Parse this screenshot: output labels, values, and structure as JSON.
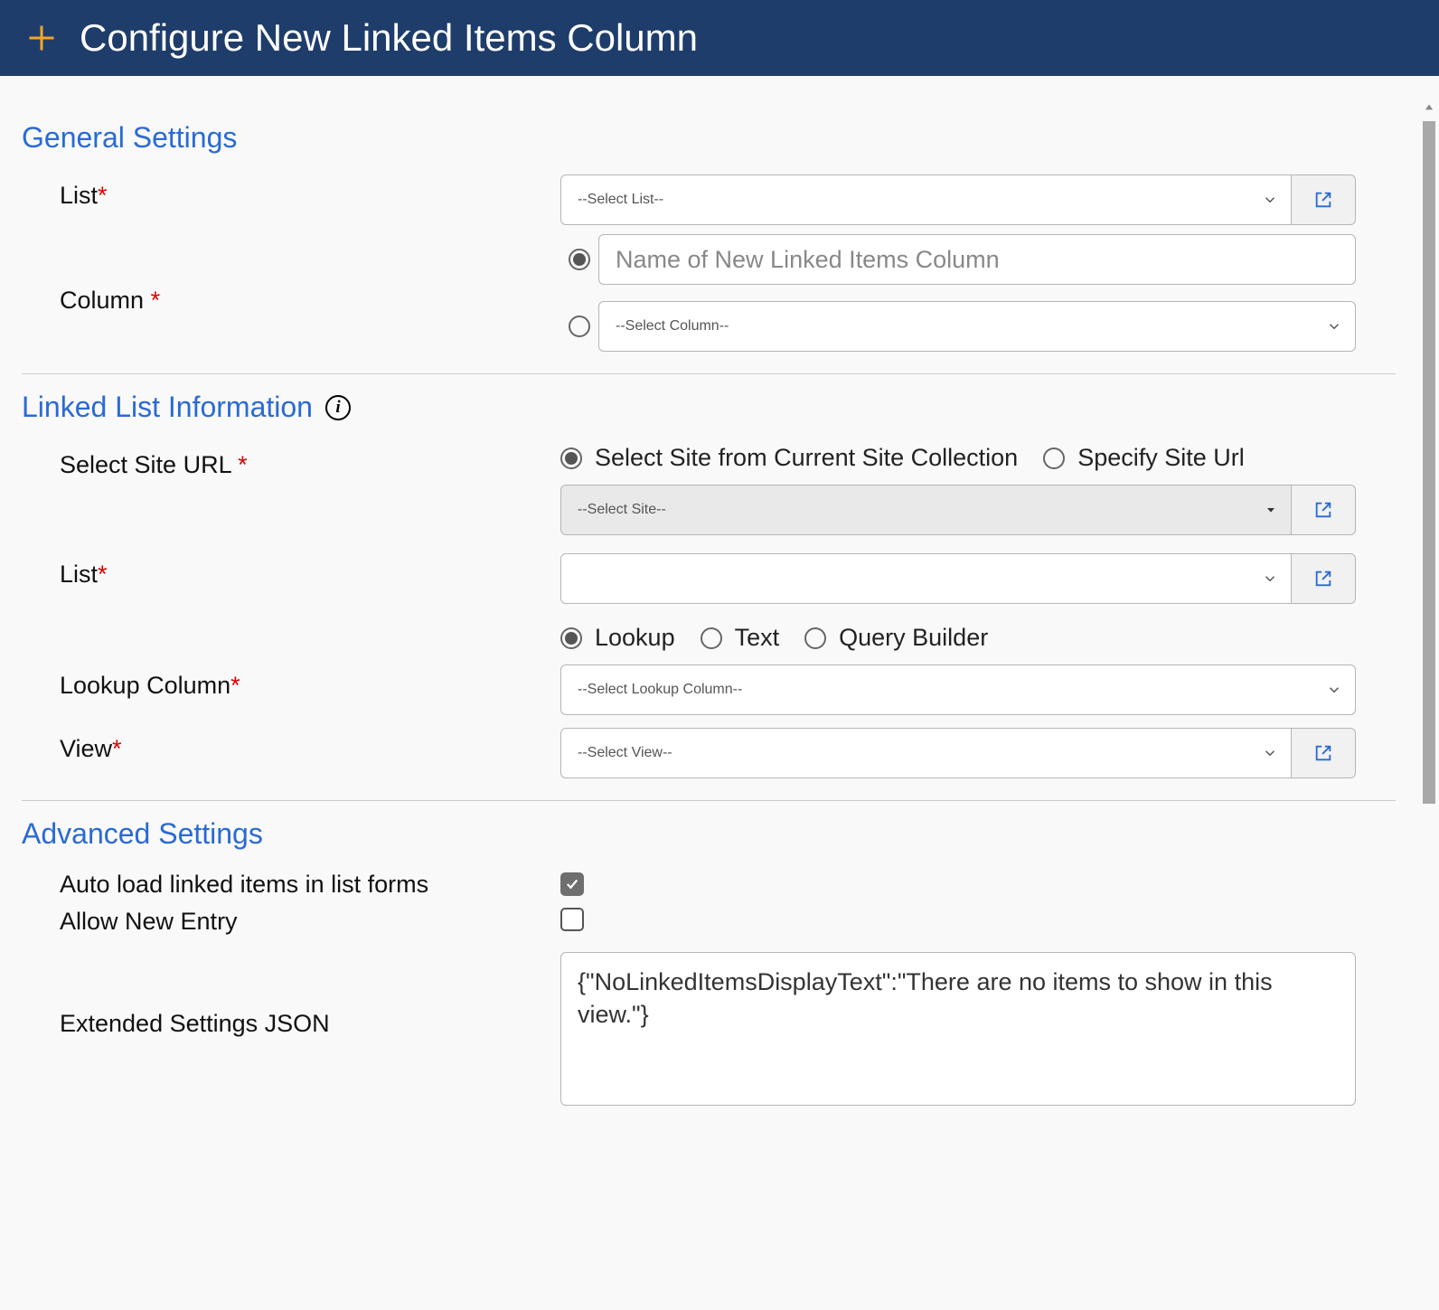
{
  "header": {
    "title": "Configure New Linked Items Column"
  },
  "sections": {
    "general": {
      "title": "General Settings",
      "listLabel": "List",
      "listSelect": "--Select List--",
      "columnLabel": "Column",
      "newColPlaceholder": "Name of New Linked Items Column",
      "selectColumn": "--Select Column--"
    },
    "linked": {
      "title": "Linked List Information",
      "siteUrlLabel": "Select Site URL",
      "siteFromCollection": "Select Site from Current Site Collection",
      "specifySiteUrl": "Specify Site Url",
      "siteSelect": "--Select Site--",
      "listLabel": "List",
      "lkLookup": "Lookup",
      "lkText": "Text",
      "lkQB": "Query Builder",
      "lookupColLabel": "Lookup Column",
      "lookupColSelect": "--Select Lookup Column--",
      "viewLabel": "View",
      "viewSelect": "--Select View--"
    },
    "advanced": {
      "title": "Advanced Settings",
      "autoLoadLabel": "Auto load linked items in list forms",
      "allowNewLabel": "Allow New Entry",
      "extJsonLabel": "Extended Settings JSON",
      "extJsonValue": "{\"NoLinkedItemsDisplayText\":\"There are no items to show in this view.\"}"
    }
  },
  "req": "*"
}
